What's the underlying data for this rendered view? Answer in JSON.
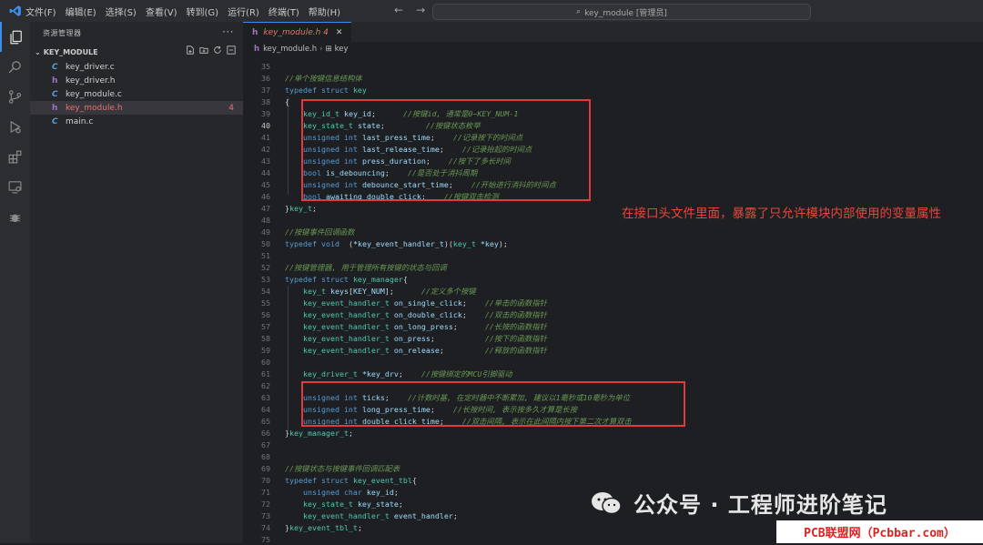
{
  "titlebar": {
    "menus": [
      "文件(F)",
      "编辑(E)",
      "选择(S)",
      "查看(V)",
      "转到(G)",
      "运行(R)",
      "终端(T)",
      "帮助(H)"
    ],
    "search": "key_module [管理员]"
  },
  "sidebar": {
    "title": "资源管理器",
    "folder": "KEY_MODULE",
    "files": [
      {
        "name": "key_driver.c",
        "type": "C"
      },
      {
        "name": "key_driver.h",
        "type": "h"
      },
      {
        "name": "key_module.c",
        "type": "C"
      },
      {
        "name": "key_module.h",
        "type": "h",
        "badge": "4"
      },
      {
        "name": "main.c",
        "type": "C"
      }
    ]
  },
  "editor": {
    "tab": {
      "label": "key_module.h 4",
      "icon": "h"
    },
    "breadcrumb": [
      "key_module.h",
      "key"
    ]
  },
  "code": [
    {
      "n": "35",
      "s": []
    },
    {
      "n": "36",
      "s": [
        [
          "c",
          "//单个按键信息结构体"
        ]
      ]
    },
    {
      "n": "37",
      "s": [
        [
          "k",
          "typedef struct "
        ],
        [
          "t",
          "key"
        ]
      ]
    },
    {
      "n": "38",
      "s": [
        [
          "txt",
          "{"
        ]
      ]
    },
    {
      "n": "39",
      "s": [
        [
          "txt",
          "    "
        ],
        [
          "t",
          "key_id_t"
        ],
        [
          "txt",
          " "
        ],
        [
          "v",
          "key_id"
        ],
        [
          "txt",
          ";      "
        ],
        [
          "c",
          "//按键id, 通常是0~KEY_NUM-1"
        ]
      ]
    },
    {
      "n": "40",
      "s": [
        [
          "txt",
          "    "
        ],
        [
          "t",
          "key_state_t"
        ],
        [
          "txt",
          " "
        ],
        [
          "v",
          "state"
        ],
        [
          "txt",
          ";         "
        ],
        [
          "c",
          "//按键状态枚举"
        ]
      ]
    },
    {
      "n": "41",
      "s": [
        [
          "txt",
          "    "
        ],
        [
          "k",
          "unsigned int"
        ],
        [
          "txt",
          " "
        ],
        [
          "v",
          "last_press_time"
        ],
        [
          "txt",
          ";    "
        ],
        [
          "c",
          "//记录按下的时间点"
        ]
      ]
    },
    {
      "n": "42",
      "s": [
        [
          "txt",
          "    "
        ],
        [
          "k",
          "unsigned int"
        ],
        [
          "txt",
          " "
        ],
        [
          "v",
          "last_release_time"
        ],
        [
          "txt",
          ";    "
        ],
        [
          "c",
          "//记录抬起的时间点"
        ]
      ]
    },
    {
      "n": "43",
      "s": [
        [
          "txt",
          "    "
        ],
        [
          "k",
          "unsigned int"
        ],
        [
          "txt",
          " "
        ],
        [
          "v",
          "press_duration"
        ],
        [
          "txt",
          ";    "
        ],
        [
          "c",
          "//按下了多长时间"
        ]
      ]
    },
    {
      "n": "44",
      "s": [
        [
          "txt",
          "    "
        ],
        [
          "k",
          "bool"
        ],
        [
          "txt",
          " "
        ],
        [
          "v",
          "is_debouncing"
        ],
        [
          "txt",
          ";    "
        ],
        [
          "c",
          "//是否处于消抖周期"
        ]
      ]
    },
    {
      "n": "45",
      "s": [
        [
          "txt",
          "    "
        ],
        [
          "k",
          "unsigned int"
        ],
        [
          "txt",
          " "
        ],
        [
          "v",
          "debounce_start_time"
        ],
        [
          "txt",
          ";    "
        ],
        [
          "c",
          "//开始进行消抖的时间点"
        ]
      ]
    },
    {
      "n": "46",
      "s": [
        [
          "txt",
          "    "
        ],
        [
          "k",
          "bool"
        ],
        [
          "txt",
          " "
        ],
        [
          "v",
          "awaiting_double_click"
        ],
        [
          "txt",
          ";    "
        ],
        [
          "c",
          "//按键双击检测"
        ]
      ]
    },
    {
      "n": "47",
      "s": [
        [
          "txt",
          "}"
        ],
        [
          "t",
          "key_t"
        ],
        [
          "txt",
          ";"
        ]
      ]
    },
    {
      "n": "48",
      "s": []
    },
    {
      "n": "49",
      "s": [
        [
          "c",
          "//按键事件回调函数"
        ]
      ]
    },
    {
      "n": "50",
      "s": [
        [
          "k",
          "typedef void"
        ],
        [
          "txt",
          "  ("
        ],
        [
          "v",
          "*key_event_handler_t"
        ],
        [
          "txt",
          ")("
        ],
        [
          "t",
          "key_t"
        ],
        [
          "txt",
          " "
        ],
        [
          "v",
          "*key"
        ],
        [
          "txt",
          ");"
        ]
      ]
    },
    {
      "n": "51",
      "s": []
    },
    {
      "n": "52",
      "s": [
        [
          "c",
          "//按键管理器, 用于管理所有按键的状态与回调"
        ]
      ]
    },
    {
      "n": "53",
      "s": [
        [
          "k",
          "typedef struct "
        ],
        [
          "t",
          "key_manager"
        ],
        [
          "txt",
          "{"
        ]
      ]
    },
    {
      "n": "54",
      "s": [
        [
          "txt",
          "    "
        ],
        [
          "t",
          "key_t"
        ],
        [
          "txt",
          " "
        ],
        [
          "v",
          "keys"
        ],
        [
          "txt",
          "["
        ],
        [
          "v",
          "KEY_NUM"
        ],
        [
          "txt",
          "];      "
        ],
        [
          "c",
          "//定义多个按键"
        ]
      ]
    },
    {
      "n": "55",
      "s": [
        [
          "txt",
          "    "
        ],
        [
          "t",
          "key_event_handler_t"
        ],
        [
          "txt",
          " "
        ],
        [
          "v",
          "on_single_click"
        ],
        [
          "txt",
          ";    "
        ],
        [
          "c",
          "//单击的函数指针"
        ]
      ]
    },
    {
      "n": "56",
      "s": [
        [
          "txt",
          "    "
        ],
        [
          "t",
          "key_event_handler_t"
        ],
        [
          "txt",
          " "
        ],
        [
          "v",
          "on_double_click"
        ],
        [
          "txt",
          ";    "
        ],
        [
          "c",
          "//双击的函数指针"
        ]
      ]
    },
    {
      "n": "57",
      "s": [
        [
          "txt",
          "    "
        ],
        [
          "t",
          "key_event_handler_t"
        ],
        [
          "txt",
          " "
        ],
        [
          "v",
          "on_long_press"
        ],
        [
          "txt",
          ";      "
        ],
        [
          "c",
          "//长按的函数指针"
        ]
      ]
    },
    {
      "n": "58",
      "s": [
        [
          "txt",
          "    "
        ],
        [
          "t",
          "key_event_handler_t"
        ],
        [
          "txt",
          " "
        ],
        [
          "v",
          "on_press"
        ],
        [
          "txt",
          ";           "
        ],
        [
          "c",
          "//按下的函数指针"
        ]
      ]
    },
    {
      "n": "59",
      "s": [
        [
          "txt",
          "    "
        ],
        [
          "t",
          "key_event_handler_t"
        ],
        [
          "txt",
          " "
        ],
        [
          "v",
          "on_release"
        ],
        [
          "txt",
          ";         "
        ],
        [
          "c",
          "//释放的函数指针"
        ]
      ]
    },
    {
      "n": "60",
      "s": []
    },
    {
      "n": "61",
      "s": [
        [
          "txt",
          "    "
        ],
        [
          "t",
          "key_driver_t"
        ],
        [
          "txt",
          " "
        ],
        [
          "v",
          "*key_drv"
        ],
        [
          "txt",
          ";    "
        ],
        [
          "c",
          "//按键绑定的MCU引脚驱动"
        ]
      ]
    },
    {
      "n": "62",
      "s": []
    },
    {
      "n": "63",
      "s": [
        [
          "txt",
          "    "
        ],
        [
          "k",
          "unsigned int"
        ],
        [
          "txt",
          " "
        ],
        [
          "v",
          "ticks"
        ],
        [
          "txt",
          ";    "
        ],
        [
          "c",
          "//计数时基, 在定时器中不断累加, 建议以1毫秒或10毫秒为单位"
        ]
      ]
    },
    {
      "n": "64",
      "s": [
        [
          "txt",
          "    "
        ],
        [
          "k",
          "unsigned int"
        ],
        [
          "txt",
          " "
        ],
        [
          "v",
          "long_press_time"
        ],
        [
          "txt",
          ";    "
        ],
        [
          "c",
          "//长按时间, 表示按多久才算是长按"
        ]
      ]
    },
    {
      "n": "65",
      "s": [
        [
          "txt",
          "    "
        ],
        [
          "k",
          "unsigned int"
        ],
        [
          "txt",
          " "
        ],
        [
          "v",
          "double_click_time"
        ],
        [
          "txt",
          ";    "
        ],
        [
          "c",
          "//双击间隔, 表示在此间隔内按下第二次才算双击"
        ]
      ]
    },
    {
      "n": "66",
      "s": [
        [
          "txt",
          "}"
        ],
        [
          "t",
          "key_manager_t"
        ],
        [
          "txt",
          ";"
        ]
      ]
    },
    {
      "n": "67",
      "s": []
    },
    {
      "n": "68",
      "s": []
    },
    {
      "n": "69",
      "s": [
        [
          "c",
          "//按键状态与按键事件回调匹配表"
        ]
      ]
    },
    {
      "n": "70",
      "s": [
        [
          "k",
          "typedef struct "
        ],
        [
          "t",
          "key_event_tbl"
        ],
        [
          "txt",
          "{"
        ]
      ]
    },
    {
      "n": "71",
      "s": [
        [
          "txt",
          "    "
        ],
        [
          "k",
          "unsigned char"
        ],
        [
          "txt",
          " "
        ],
        [
          "v",
          "key_id"
        ],
        [
          "txt",
          ";"
        ]
      ]
    },
    {
      "n": "72",
      "s": [
        [
          "txt",
          "    "
        ],
        [
          "t",
          "key_state_t"
        ],
        [
          "txt",
          " "
        ],
        [
          "v",
          "key_state"
        ],
        [
          "txt",
          ";"
        ]
      ]
    },
    {
      "n": "73",
      "s": [
        [
          "txt",
          "    "
        ],
        [
          "t",
          "key_event_handler_t"
        ],
        [
          "txt",
          " "
        ],
        [
          "v",
          "event_handler"
        ],
        [
          "txt",
          ";"
        ]
      ]
    },
    {
      "n": "74",
      "s": [
        [
          "txt",
          "}"
        ],
        [
          "t",
          "key_event_tbl_t"
        ],
        [
          "txt",
          ";"
        ]
      ]
    },
    {
      "n": "75",
      "s": []
    }
  ],
  "current_line": "40",
  "annotation": "在接口头文件里面，暴露了只允许模块内部使用的变量属性",
  "watermark": {
    "wechat": "公众号 · 工程师进阶笔记",
    "site": "PCB联盟网（Pcbbar.com）"
  },
  "colors": {
    "accent": "#3b8eea",
    "highlight_box": "#e0393e",
    "annotation_text": "#e8463c"
  }
}
